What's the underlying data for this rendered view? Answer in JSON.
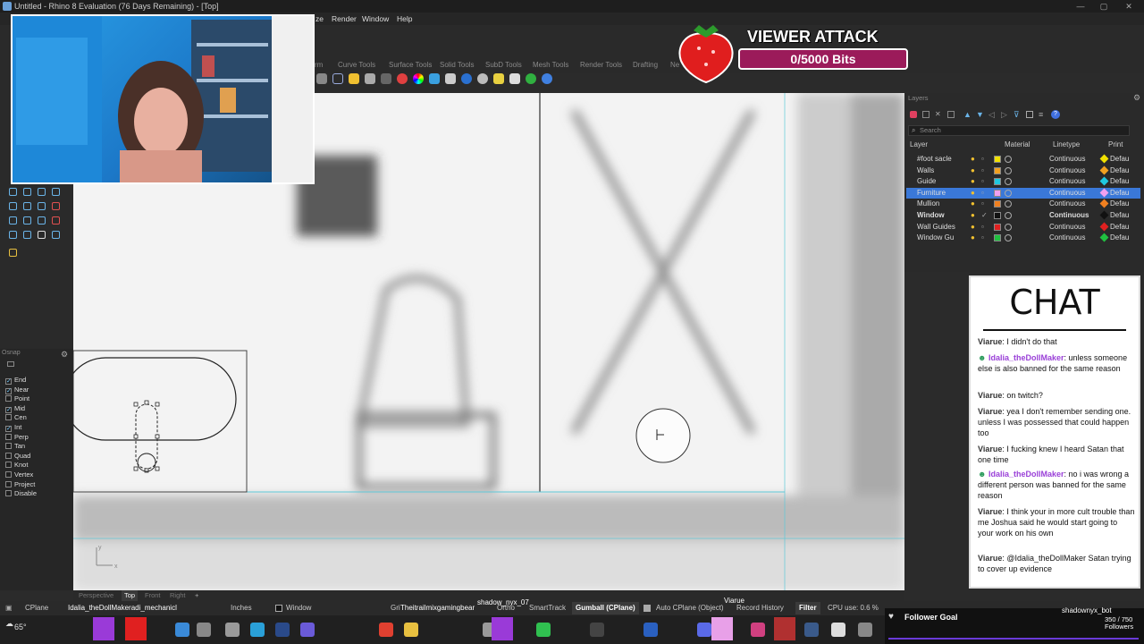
{
  "window": {
    "title": "Untitled - Rhino 8 Evaluation (76 Days Remaining) - [Top]"
  },
  "menu": {
    "items": [
      "ze",
      "Render",
      "Window",
      "Help"
    ]
  },
  "toolbar_tabs": [
    "rm",
    "Curve Tools",
    "Surface Tools",
    "Solid Tools",
    "SubD Tools",
    "Mesh Tools",
    "Render Tools",
    "Drafting",
    "Ne"
  ],
  "viewer_attack": {
    "title": "VIEWER ATTACK",
    "progress": "0/5000 Bits",
    "progress_fraction": 0,
    "accent": "#9b1b5a"
  },
  "layers": {
    "panel_title": "Layers",
    "search_placeholder": "Search",
    "headers": {
      "layer": "Layer",
      "material": "Material",
      "linetype": "Linetype",
      "print": "Print"
    },
    "rows": [
      {
        "name": "#foot sacle",
        "color": "#f0e000",
        "linetype": "Continuous",
        "print": "Defau",
        "selected": false,
        "current": false
      },
      {
        "name": "Walls",
        "color": "#f0a020",
        "linetype": "Continuous",
        "print": "Defau",
        "selected": false,
        "current": false
      },
      {
        "name": "Guide",
        "color": "#20c8e0",
        "linetype": "Continuous",
        "print": "Defau",
        "selected": false,
        "current": false
      },
      {
        "name": "Furniture",
        "color": "#f0a0f0",
        "linetype": "Continuous",
        "print": "Defau",
        "selected": true,
        "current": false
      },
      {
        "name": "Mullion",
        "color": "#f08020",
        "linetype": "Continuous",
        "print": "Defau",
        "selected": false,
        "current": false
      },
      {
        "name": "Window",
        "color": "#111111",
        "linetype": "Continuous",
        "print": "Defau",
        "selected": false,
        "current": true
      },
      {
        "name": "Wall Guides",
        "color": "#e02020",
        "linetype": "Continuous",
        "print": "Defau",
        "selected": false,
        "current": false
      },
      {
        "name": "Window Gu",
        "color": "#20c040",
        "linetype": "Continuous",
        "print": "Defau",
        "selected": false,
        "current": false
      }
    ]
  },
  "chat": {
    "title": "CHAT",
    "messages": [
      {
        "user": "Viarue",
        "text": "I didn't do that",
        "badge": false
      },
      {
        "user": "Idalia_theDollMaker",
        "text": "unless someone else is also banned for the same reason",
        "badge": true
      },
      {
        "user": "Viarue",
        "text": "on twitch?",
        "badge": false
      },
      {
        "user": "Viarue",
        "text": "yea I don't remember sending one. unless I was possessed that could happen too",
        "badge": false
      },
      {
        "user": "Viarue",
        "text": "I fucking knew I heard Satan that one time",
        "badge": false
      },
      {
        "user": "Idalia_theDollMaker",
        "text": "no i was wrong a different person was banned for the same reason",
        "badge": true
      },
      {
        "user": "Viarue",
        "text": "I think your in more cult trouble than me Joshua said he would start going to your work on his own",
        "badge": false
      },
      {
        "user": "Viarue",
        "text": "@Idalia_theDollMaker Satan trying to cover up evidence",
        "badge": false
      }
    ]
  },
  "osnap": {
    "title": "Osnap",
    "items": [
      {
        "label": "End",
        "checked": true
      },
      {
        "label": "Near",
        "checked": true
      },
      {
        "label": "Point",
        "checked": false
      },
      {
        "label": "Mid",
        "checked": true
      },
      {
        "label": "Cen",
        "checked": false
      },
      {
        "label": "Int",
        "checked": true
      },
      {
        "label": "Perp",
        "checked": false
      },
      {
        "label": "Tan",
        "checked": false
      },
      {
        "label": "Quad",
        "checked": false
      },
      {
        "label": "Knot",
        "checked": false
      },
      {
        "label": "Vertex",
        "checked": false
      },
      {
        "label": "Project",
        "checked": false
      },
      {
        "label": "Disable",
        "checked": false
      }
    ]
  },
  "viewport_tabs": [
    "Perspective",
    "Top",
    "Front",
    "Right"
  ],
  "status": {
    "cplane": "CPlane",
    "overlay_text": "Idalia_theDollMakeradi_mechanicl",
    "units": "Inches",
    "layer": "Window",
    "grid_snap": "Gri",
    "stream_overlay": "Theitrailmixgamingbear",
    "shadow_text": "shadow_nyx_07",
    "ortho": "Ortho",
    "smarttrack": "SmartTrack",
    "gumball": "Gumball (CPlane)",
    "auto_cplane": "Auto CPlane (Object)",
    "record_history": "Record History",
    "filter": "Filter",
    "cpu": "CPU use: 0.6 %",
    "viarue_tag": "Viarue"
  },
  "taskbar": {
    "weather": "65°",
    "follower_goal": "Follower Goal",
    "follower_user": "shadownyx_bot",
    "follower_count": "350 / 750",
    "follower_label": "Followers"
  }
}
